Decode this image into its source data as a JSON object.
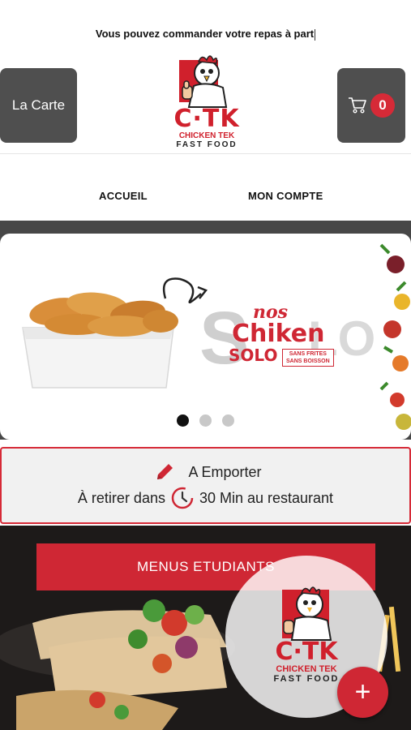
{
  "header": {
    "marquee_text": "Vous pouvez commander votre repas à part",
    "carte_button_label": "La Carte",
    "cart_count": "0",
    "cart_icon": "shopping-cart-icon"
  },
  "logo": {
    "name": "C·TK",
    "line1": "CHICKEN TEK",
    "line2": "FAST FOOD"
  },
  "nav": {
    "items": [
      {
        "label": "ACCUEIL"
      },
      {
        "label": "MON COMPTE"
      }
    ]
  },
  "banner": {
    "script_text": "nos",
    "title": "Chiken",
    "subtitle": "SOLO",
    "tag_line1": "SANS FRITES",
    "tag_line2": "SANS BOISSON",
    "slides_total": 3,
    "active_slide": 1
  },
  "pickup": {
    "mode_label": "A Emporter",
    "prefix": "À retirer dans",
    "suffix": "30 Min au restaurant",
    "edit_icon": "pencil-icon",
    "clock_icon": "clock-icon"
  },
  "menus": {
    "button_label": "MENUS ETUDIANTS"
  },
  "fab": {
    "plus_label": "+"
  },
  "colors": {
    "brand_red": "#cf2734",
    "dark_gray": "#4f4f4f"
  }
}
